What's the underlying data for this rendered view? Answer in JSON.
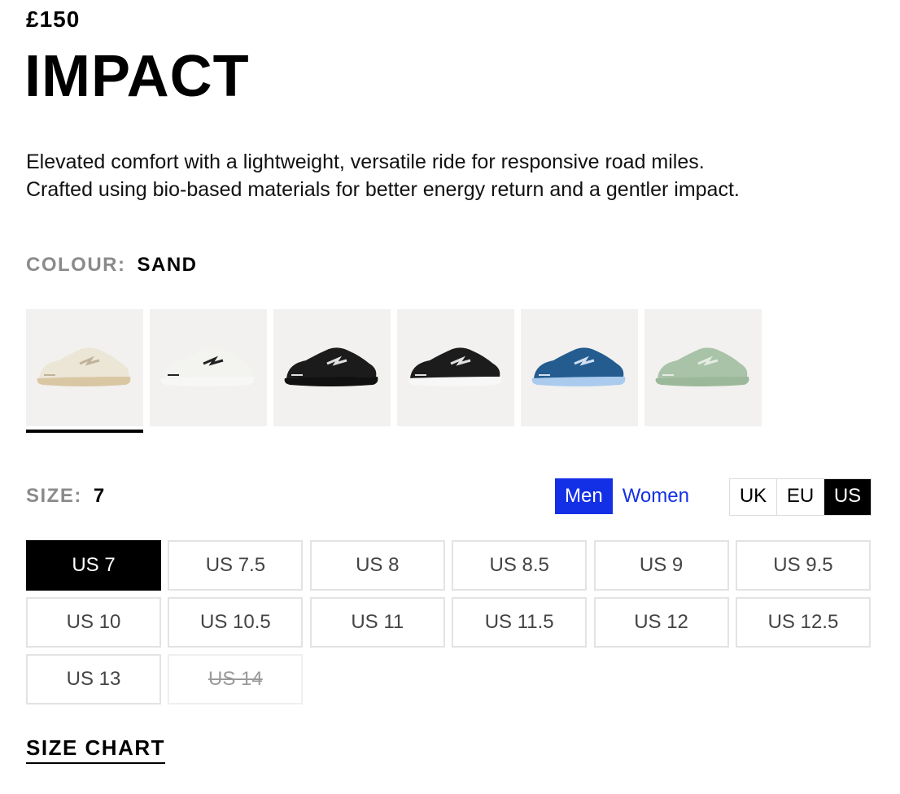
{
  "product": {
    "price": "£150",
    "name": "IMPACT",
    "description_line1": "Elevated comfort with a lightweight, versatile ride for responsive road miles.",
    "description_line2": "Crafted using bio-based materials for better energy return and a gentler impact."
  },
  "colour": {
    "label": "COLOUR:",
    "value": "SAND",
    "swatches": [
      {
        "name": "sand",
        "upper": "#ece6d6",
        "sole": "#d9c6a3",
        "accent": "#bfb39a",
        "selected": true
      },
      {
        "name": "white-black",
        "upper": "#f3f3f0",
        "sole": "#f7f7f5",
        "accent": "#222222",
        "selected": false
      },
      {
        "name": "black",
        "upper": "#1b1b1b",
        "sole": "#111111",
        "accent": "#e0e0e0",
        "selected": false
      },
      {
        "name": "black-white",
        "upper": "#1c1c1c",
        "sole": "#f7f7f7",
        "accent": "#e0e0e0",
        "selected": false
      },
      {
        "name": "blue",
        "upper": "#245c8f",
        "sole": "#aacbee",
        "accent": "#cfe0f0",
        "selected": false
      },
      {
        "name": "sage",
        "upper": "#a9c3a8",
        "sole": "#9cb89a",
        "accent": "#e4ece2",
        "selected": false
      }
    ]
  },
  "size": {
    "label": "SIZE:",
    "value": "7",
    "gender_options": [
      "Men",
      "Women"
    ],
    "active_gender": "Men",
    "unit_options": [
      "UK",
      "EU",
      "US"
    ],
    "active_unit": "US",
    "sizes": [
      {
        "label": "US 7",
        "state": "selected"
      },
      {
        "label": "US 7.5",
        "state": "available"
      },
      {
        "label": "US 8",
        "state": "available"
      },
      {
        "label": "US 8.5",
        "state": "available"
      },
      {
        "label": "US 9",
        "state": "available"
      },
      {
        "label": "US 9.5",
        "state": "available"
      },
      {
        "label": "US 10",
        "state": "available"
      },
      {
        "label": "US 10.5",
        "state": "available"
      },
      {
        "label": "US 11",
        "state": "available"
      },
      {
        "label": "US 11.5",
        "state": "available"
      },
      {
        "label": "US 12",
        "state": "available"
      },
      {
        "label": "US 12.5",
        "state": "available"
      },
      {
        "label": "US 13",
        "state": "available"
      },
      {
        "label": "US 14",
        "state": "unavailable"
      }
    ],
    "size_chart_label": "SIZE CHART"
  },
  "colors": {
    "accent_blue": "#1430e6",
    "selected_black": "#000000",
    "muted_label": "#8a8a8a"
  }
}
